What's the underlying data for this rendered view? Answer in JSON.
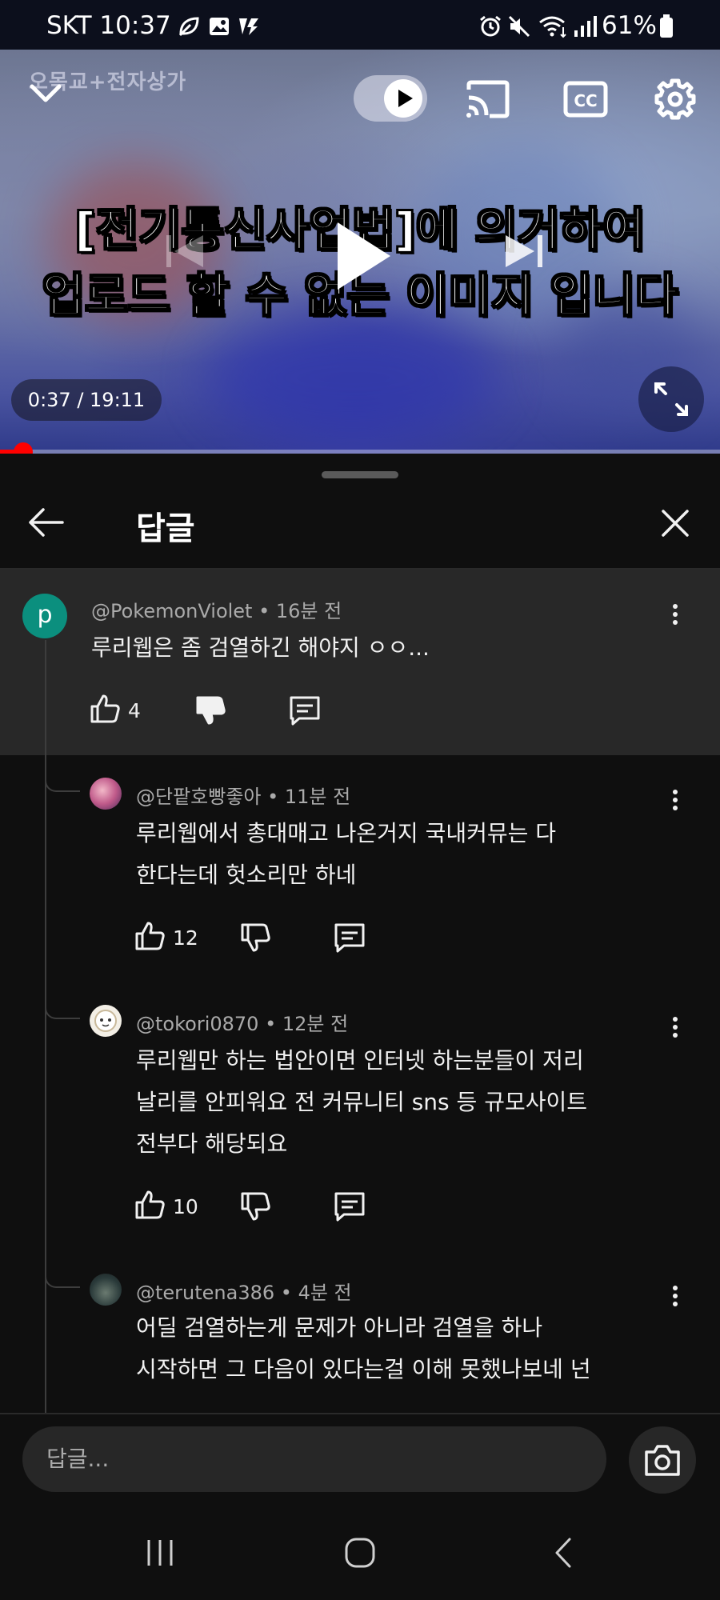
{
  "status_bar": {
    "carrier_time": "SKT 10:37",
    "battery": "61%"
  },
  "video": {
    "watermark": "오목교+전자상가",
    "overlay_line1": "[전기통신사업법]에 의거하여",
    "overlay_line2": "업로드 할 수 없는 이미지 입니다",
    "time_display": "0:37 / 19:11",
    "progress_fraction": 0.032
  },
  "header": {
    "title": "답글"
  },
  "parent_comment": {
    "avatar_letter": "p",
    "avatar_color": "#0b8f7e",
    "author_meta": "@PokemonViolet • 16분 전",
    "text": "루리웹은 좀 검열하긴 해야지 ㅇㅇ...",
    "likes": "4"
  },
  "replies": [
    {
      "author_meta": "@단팥호빵좋아 • 11분 전",
      "lines": [
        "루리웹에서 총대매고 나온거지 국내커뮤는 다",
        "한다는데 헛소리만 하네"
      ],
      "likes": "12"
    },
    {
      "author_meta": "@tokori0870 • 12분 전",
      "lines": [
        "루리웹만 하는 법안이면 인터넷 하는분들이 저리",
        "날리를 안피워요 전 커뮤니티 sns 등 규모사이트",
        "전부다 해당되요"
      ],
      "likes": "10"
    },
    {
      "author_meta": "@terutena386 • 4분 전",
      "lines": [
        "어딜 검열하는게 문제가 아니라 검열을 하나",
        "시작하면 그 다음이 있다는걸 이해 못했나보네 넌"
      ]
    }
  ],
  "reply_input": {
    "placeholder": "답글..."
  },
  "colors": {
    "progress": "#ff0000",
    "background": "#0f0f0f"
  }
}
